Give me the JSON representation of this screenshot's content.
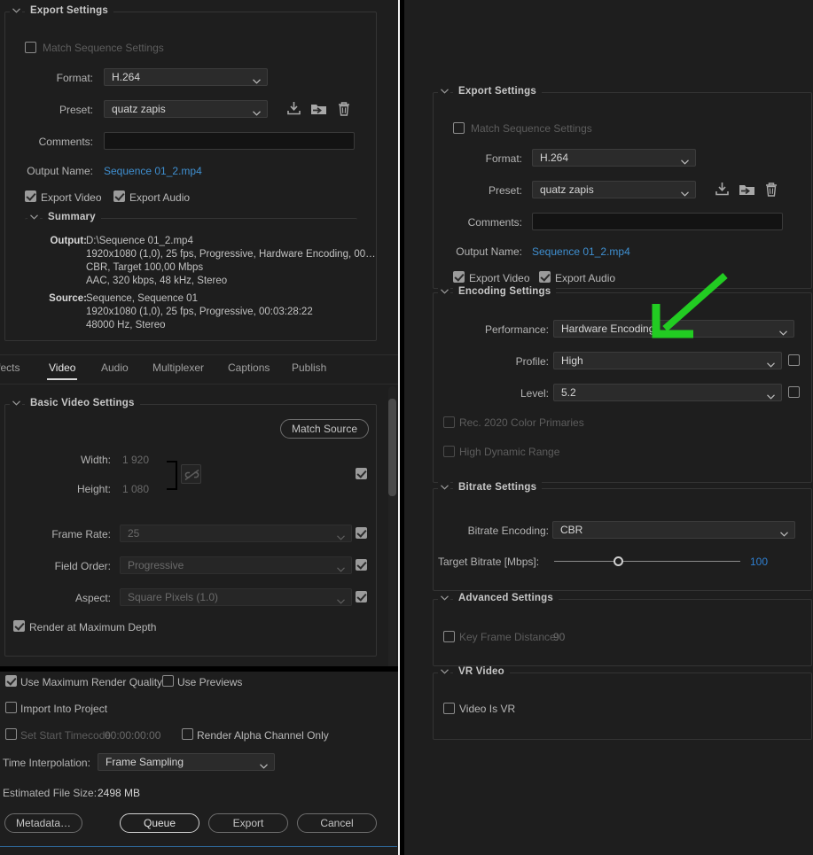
{
  "left_panel": {
    "export_settings": {
      "title": "Export Settings",
      "match_sequence_settings": "Match Sequence Settings",
      "format_label": "Format:",
      "format_value": "H.264",
      "preset_label": "Preset:",
      "preset_value": "quatz zapis",
      "comments_label": "Comments:",
      "comments_value": "",
      "output_name_label": "Output Name:",
      "output_name_value": "Sequence 01_2.mp4",
      "export_video": "Export Video",
      "export_audio": "Export Audio"
    },
    "summary": {
      "title": "Summary",
      "output_key": "Output:",
      "output_lines": [
        "D:\\Sequence 01_2.mp4",
        "1920x1080 (1,0), 25 fps, Progressive, Hardware Encoding, 00…",
        "CBR, Target 100,00 Mbps",
        "AAC, 320 kbps, 48 kHz, Stereo"
      ],
      "source_key": "Source:",
      "source_lines": [
        "Sequence, Sequence 01",
        "1920x1080 (1,0), 25 fps, Progressive, 00:03:28:22",
        "48000 Hz, Stereo"
      ]
    },
    "tabs": [
      {
        "label": "ffects",
        "active": false
      },
      {
        "label": "Video",
        "active": true
      },
      {
        "label": "Audio",
        "active": false
      },
      {
        "label": "Multiplexer",
        "active": false
      },
      {
        "label": "Captions",
        "active": false
      },
      {
        "label": "Publish",
        "active": false
      }
    ],
    "basic_video": {
      "title": "Basic Video Settings",
      "match_source": "Match Source",
      "width_label": "Width:",
      "width_value": "1 920",
      "height_label": "Height:",
      "height_value": "1 080",
      "frame_rate_label": "Frame Rate:",
      "frame_rate_value": "25",
      "field_order_label": "Field Order:",
      "field_order_value": "Progressive",
      "aspect_label": "Aspect:",
      "aspect_value": "Square Pixels (1.0)",
      "render_max_depth": "Render at Maximum Depth"
    },
    "footer": {
      "use_max_render_quality": "Use Maximum Render Quality",
      "use_previews": "Use Previews",
      "import_into_project": "Import Into Project",
      "set_start_timecode": "Set Start Timecode",
      "timecode_value": "00:00:00:00",
      "render_alpha_only": "Render Alpha Channel Only",
      "time_interpolation_label": "Time Interpolation:",
      "time_interpolation_value": "Frame Sampling",
      "estimated_label": "Estimated File Size:",
      "estimated_value": "2498 MB",
      "buttons": {
        "metadata": "Metadata…",
        "queue": "Queue",
        "export": "Export",
        "cancel": "Cancel"
      }
    }
  },
  "right_panel": {
    "export_settings": {
      "title": "Export Settings",
      "match_sequence_settings": "Match Sequence Settings",
      "format_label": "Format:",
      "format_value": "H.264",
      "preset_label": "Preset:",
      "preset_value": "quatz zapis",
      "comments_label": "Comments:",
      "comments_value": "",
      "output_name_label": "Output Name:",
      "output_name_value": "Sequence 01_2.mp4",
      "export_video": "Export Video",
      "export_audio": "Export Audio"
    },
    "encoding_settings": {
      "title": "Encoding Settings",
      "performance_label": "Performance:",
      "performance_value": "Hardware Encoding",
      "profile_label": "Profile:",
      "profile_value": "High",
      "level_label": "Level:",
      "level_value": "5.2",
      "rec2020": "Rec. 2020 Color Primaries",
      "hdr": "High Dynamic Range"
    },
    "bitrate_settings": {
      "title": "Bitrate Settings",
      "bitrate_encoding_label": "Bitrate Encoding:",
      "bitrate_encoding_value": "CBR",
      "target_bitrate_label": "Target Bitrate [Mbps]:",
      "target_bitrate_value": "100",
      "target_bitrate_pct": 35
    },
    "advanced_settings": {
      "title": "Advanced Settings",
      "key_frame_distance_label": "Key Frame Distance:",
      "key_frame_distance_value": "90"
    },
    "vr_video": {
      "title": "VR Video",
      "video_is_vr": "Video Is VR"
    }
  },
  "annotation": {
    "arrow_color": "#22cc22",
    "points_at": "performance-dropdown"
  },
  "colors": {
    "background": "#1e1e1e",
    "panel_border": "#343434",
    "link_blue": "#3f8fd0",
    "accent_blue": "#2f6a9e",
    "text": "#b4b4b4",
    "text_dim": "#6a6a6a"
  }
}
